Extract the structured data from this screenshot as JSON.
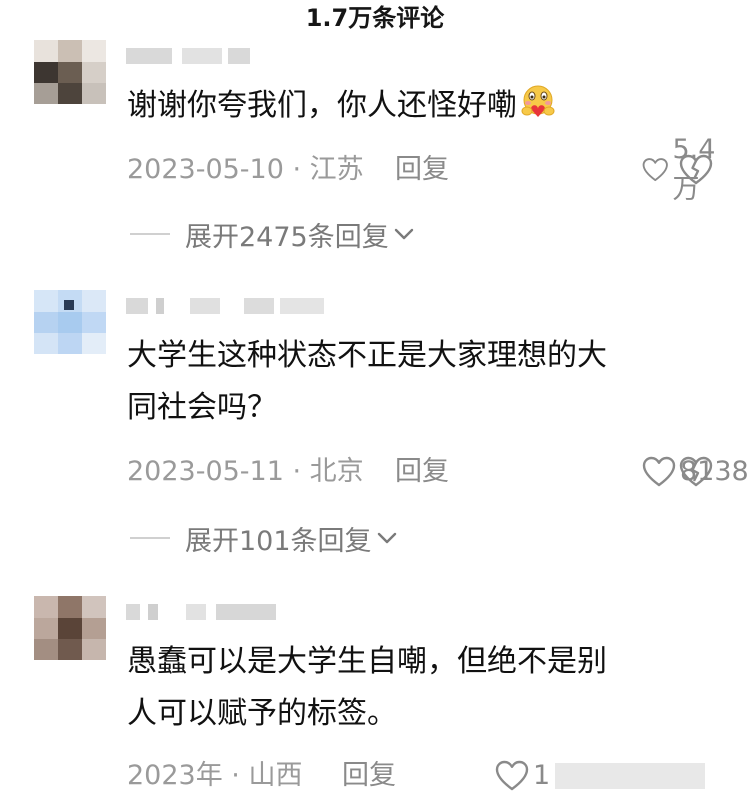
{
  "header": {
    "title": "1.7万条评论"
  },
  "comments": [
    {
      "text": "谢谢你夸我们，你人还怪好嘞",
      "date_location": "2023-05-10 · 江苏",
      "reply_label": "回复",
      "likes": "5.4万",
      "expand_label": "展开2475条回复"
    },
    {
      "text_line1": "大学生这种状态不正是大家理想的大",
      "text_line2": "同社会吗？",
      "date_location": "2023-05-11 · 北京",
      "reply_label": "回复",
      "likes": "8138",
      "expand_label": "展开101条回复"
    },
    {
      "text_line1": "愚蠢可以是大学生自嘲，但绝不是别",
      "text_line2": "人可以赋予的标签。",
      "date_location": "2023年 · 山西",
      "reply_label": "回复",
      "likes": "1"
    }
  ],
  "icons": {
    "like": "heart-outline-icon",
    "dislike": "broken-heart-icon",
    "expand": "chevron-down-icon",
    "emoji": "hugging-face-emoji-icon"
  },
  "colors": {
    "text": "#111111",
    "meta": "#9a9a9a",
    "secondary": "#7a7a7a"
  }
}
